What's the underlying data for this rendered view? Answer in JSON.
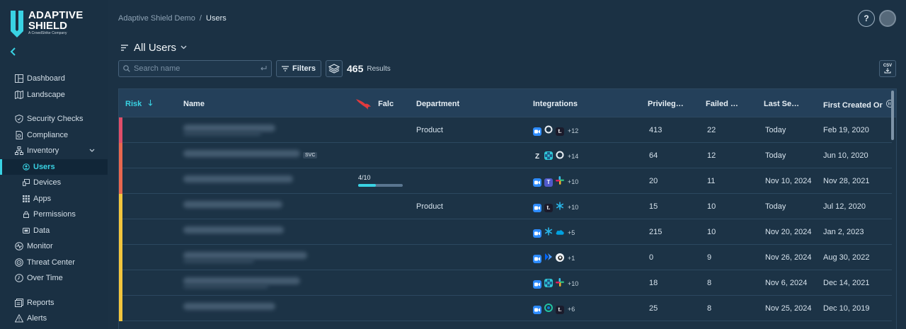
{
  "logo": {
    "line1": "ADAPTIVE",
    "line2": "SHIELD",
    "tagline": "A CrowdStrike Company"
  },
  "sidebar": {
    "items": [
      {
        "label": "Dashboard",
        "icon": "dashboard-icon"
      },
      {
        "label": "Landscape",
        "icon": "map-icon"
      },
      {
        "label": "Security Checks",
        "icon": "shield-icon"
      },
      {
        "label": "Compliance",
        "icon": "document-icon"
      },
      {
        "label": "Inventory",
        "icon": "hierarchy-icon"
      },
      {
        "label": "Users",
        "icon": "users-icon"
      },
      {
        "label": "Devices",
        "icon": "devices-icon"
      },
      {
        "label": "Apps",
        "icon": "apps-icon"
      },
      {
        "label": "Permissions",
        "icon": "lock-icon"
      },
      {
        "label": "Data",
        "icon": "data-icon"
      },
      {
        "label": "Monitor",
        "icon": "monitor-icon"
      },
      {
        "label": "Threat Center",
        "icon": "threat-icon"
      },
      {
        "label": "Over Time",
        "icon": "clock-icon"
      },
      {
        "label": "Reports",
        "icon": "reports-icon"
      },
      {
        "label": "Alerts",
        "icon": "alert-icon"
      }
    ]
  },
  "breadcrumb": {
    "parent": "Adaptive Shield Demo",
    "sep": "/",
    "current": "Users"
  },
  "header": {
    "help": "?"
  },
  "view": {
    "title": "All Users"
  },
  "toolbar": {
    "search_placeholder": "Search name",
    "filters_label": "Filters",
    "count": "465",
    "count_label": "Results",
    "csv_label": "CSV"
  },
  "table": {
    "columns": {
      "risk": "Risk",
      "name": "Name",
      "falcon": "Falc",
      "department": "Department",
      "integrations": "Integrations",
      "privileged": "Privileg…",
      "failed": "Failed …",
      "last_seen": "Last Se…",
      "first_created": "First Created Or"
    },
    "rows": [
      {
        "risk_color": "#e04e69",
        "department": "Product",
        "integrations": [
          "zoom",
          "okta",
          "teamwork"
        ],
        "more": "+12",
        "privileged": "413",
        "failed": "22",
        "last_seen": "Today",
        "first_created": "Feb 19, 2020"
      },
      {
        "risk_color": "#e8674f",
        "badge": "SVC",
        "department": "",
        "integrations": [
          "zendesk",
          "jira",
          "okta"
        ],
        "more": "+14",
        "privileged": "64",
        "failed": "12",
        "last_seen": "Today",
        "first_created": "Jun 10, 2020"
      },
      {
        "risk_color": "#e8674f",
        "score": "4/10",
        "score_value": 0.4,
        "department": "",
        "integrations": [
          "zoom",
          "teams",
          "slack"
        ],
        "more": "+10",
        "privileged": "20",
        "failed": "11",
        "last_seen": "Nov 10, 2024",
        "first_created": "Nov 28, 2021"
      },
      {
        "risk_color": "#f2c53d",
        "department": "Product",
        "integrations": [
          "zoom",
          "teamwork",
          "snowflake"
        ],
        "more": "+10",
        "privileged": "15",
        "failed": "10",
        "last_seen": "Today",
        "first_created": "Jul 12, 2020"
      },
      {
        "risk_color": "#f2c53d",
        "department": "",
        "integrations": [
          "zoom",
          "snowflake",
          "salesforce"
        ],
        "more": "+5",
        "privileged": "215",
        "failed": "10",
        "last_seen": "Nov 20, 2024",
        "first_created": "Jan 2, 2023"
      },
      {
        "risk_color": "#f2c53d",
        "department": "",
        "integrations": [
          "zoom",
          "powerautomate",
          "github"
        ],
        "more": "+1",
        "privileged": "0",
        "failed": "9",
        "last_seen": "Nov 26, 2024",
        "first_created": "Aug 30, 2022"
      },
      {
        "risk_color": "#f2c53d",
        "department": "",
        "integrations": [
          "zoom",
          "jira",
          "slack"
        ],
        "more": "+10",
        "privileged": "18",
        "failed": "8",
        "last_seen": "Nov 6, 2024",
        "first_created": "Dec 14, 2021"
      },
      {
        "risk_color": "#f2c53d",
        "department": "",
        "integrations": [
          "zoom",
          "webex",
          "teamwork"
        ],
        "more": "+6",
        "privileged": "25",
        "failed": "8",
        "last_seen": "Nov 25, 2024",
        "first_created": "Dec 10, 2019"
      }
    ]
  },
  "colors": {
    "accent": "#39d2e3",
    "background": "#1b3144"
  }
}
